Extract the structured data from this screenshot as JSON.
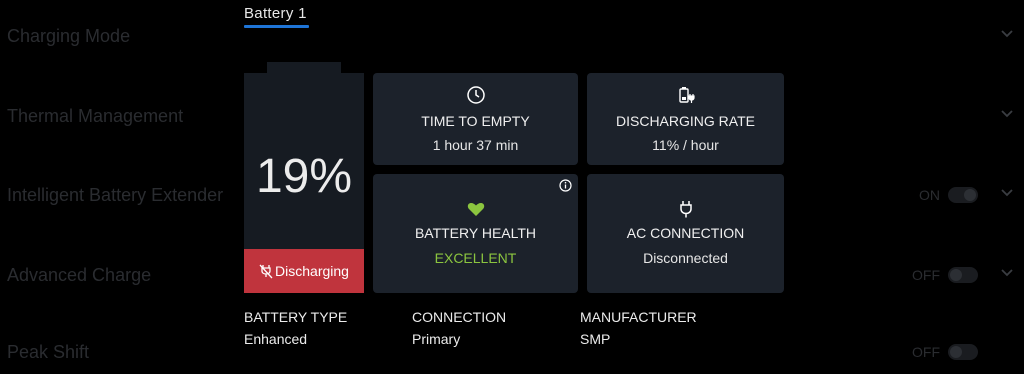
{
  "background_settings": [
    {
      "label": "Charging Mode",
      "toggle": null
    },
    {
      "label": "Thermal Management",
      "toggle": null
    },
    {
      "label": "Intelligent Battery Extender",
      "toggle": "ON"
    },
    {
      "label": "Advanced Charge",
      "toggle": "OFF"
    },
    {
      "label": "Peak Shift",
      "toggle": "OFF"
    }
  ],
  "tab": {
    "label": "Battery 1"
  },
  "battery": {
    "percent": "19%",
    "status": "Discharging",
    "status_color": "#c0343d"
  },
  "cards": {
    "time_to_empty": {
      "title": "TIME TO EMPTY",
      "value": "1 hour  37 min",
      "icon": "clock-icon"
    },
    "discharging_rate": {
      "title": "DISCHARGING RATE",
      "value": "11% / hour",
      "icon": "battery-plug-icon"
    },
    "battery_health": {
      "title": "BATTERY HEALTH",
      "value": "EXCELLENT",
      "icon": "heart-icon",
      "value_color": "#8bc53f"
    },
    "ac_connection": {
      "title": "AC CONNECTION",
      "value": "Disconnected",
      "icon": "plug-icon"
    }
  },
  "details": [
    {
      "label": "BATTERY TYPE",
      "value": "Enhanced"
    },
    {
      "label": "CONNECTION",
      "value": "Primary"
    },
    {
      "label": "MANUFACTURER",
      "value": "SMP"
    }
  ],
  "colors": {
    "accent": "#1e74d6",
    "card_bg": "#1c222b",
    "battery_bg": "#161b22"
  }
}
